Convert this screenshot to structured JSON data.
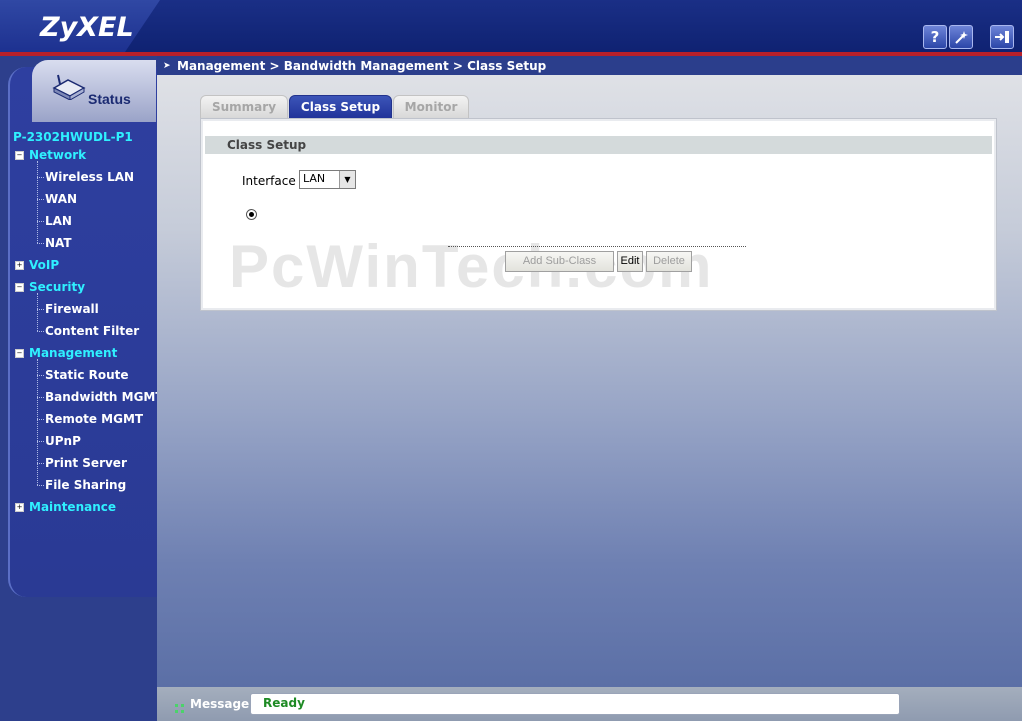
{
  "header": {
    "logo": "ZyXEL",
    "help_icon": "?",
    "wizard_icon": "wand-icon",
    "logout_icon": "logout-icon"
  },
  "sidebar": {
    "status_label": "Status",
    "device_name": "P-2302HWUDL-P1",
    "sections": [
      {
        "label": "Network",
        "expanded": true,
        "items": [
          "Wireless LAN",
          "WAN",
          "LAN",
          "NAT"
        ]
      },
      {
        "label": "VoIP",
        "expanded": false,
        "items": []
      },
      {
        "label": "Security",
        "expanded": true,
        "items": [
          "Firewall",
          "Content Filter"
        ]
      },
      {
        "label": "Management",
        "expanded": true,
        "items": [
          "Static Route",
          "Bandwidth MGMT",
          "Remote MGMT",
          "UPnP",
          "Print Server",
          "File Sharing"
        ]
      },
      {
        "label": "Maintenance",
        "expanded": false,
        "items": []
      }
    ]
  },
  "breadcrumb": "Management > Bandwidth Management > Class Setup",
  "tabs": [
    {
      "label": "Summary",
      "active": false
    },
    {
      "label": "Class Setup",
      "active": true
    },
    {
      "label": "Monitor",
      "active": false
    }
  ],
  "panel": {
    "title": "Class Setup",
    "interface_label": "Interface",
    "interface_value": "LAN",
    "buttons": {
      "add_sub_class": "Add Sub-Class",
      "edit": "Edit",
      "delete": "Delete"
    }
  },
  "watermark": "PcWinTech.com",
  "message": {
    "label": "Message",
    "value": "Ready"
  },
  "colors": {
    "accent": "#21339a",
    "link": "#2ff0ff",
    "status_ok": "#1e8a24",
    "header_red": "#b8202a"
  }
}
